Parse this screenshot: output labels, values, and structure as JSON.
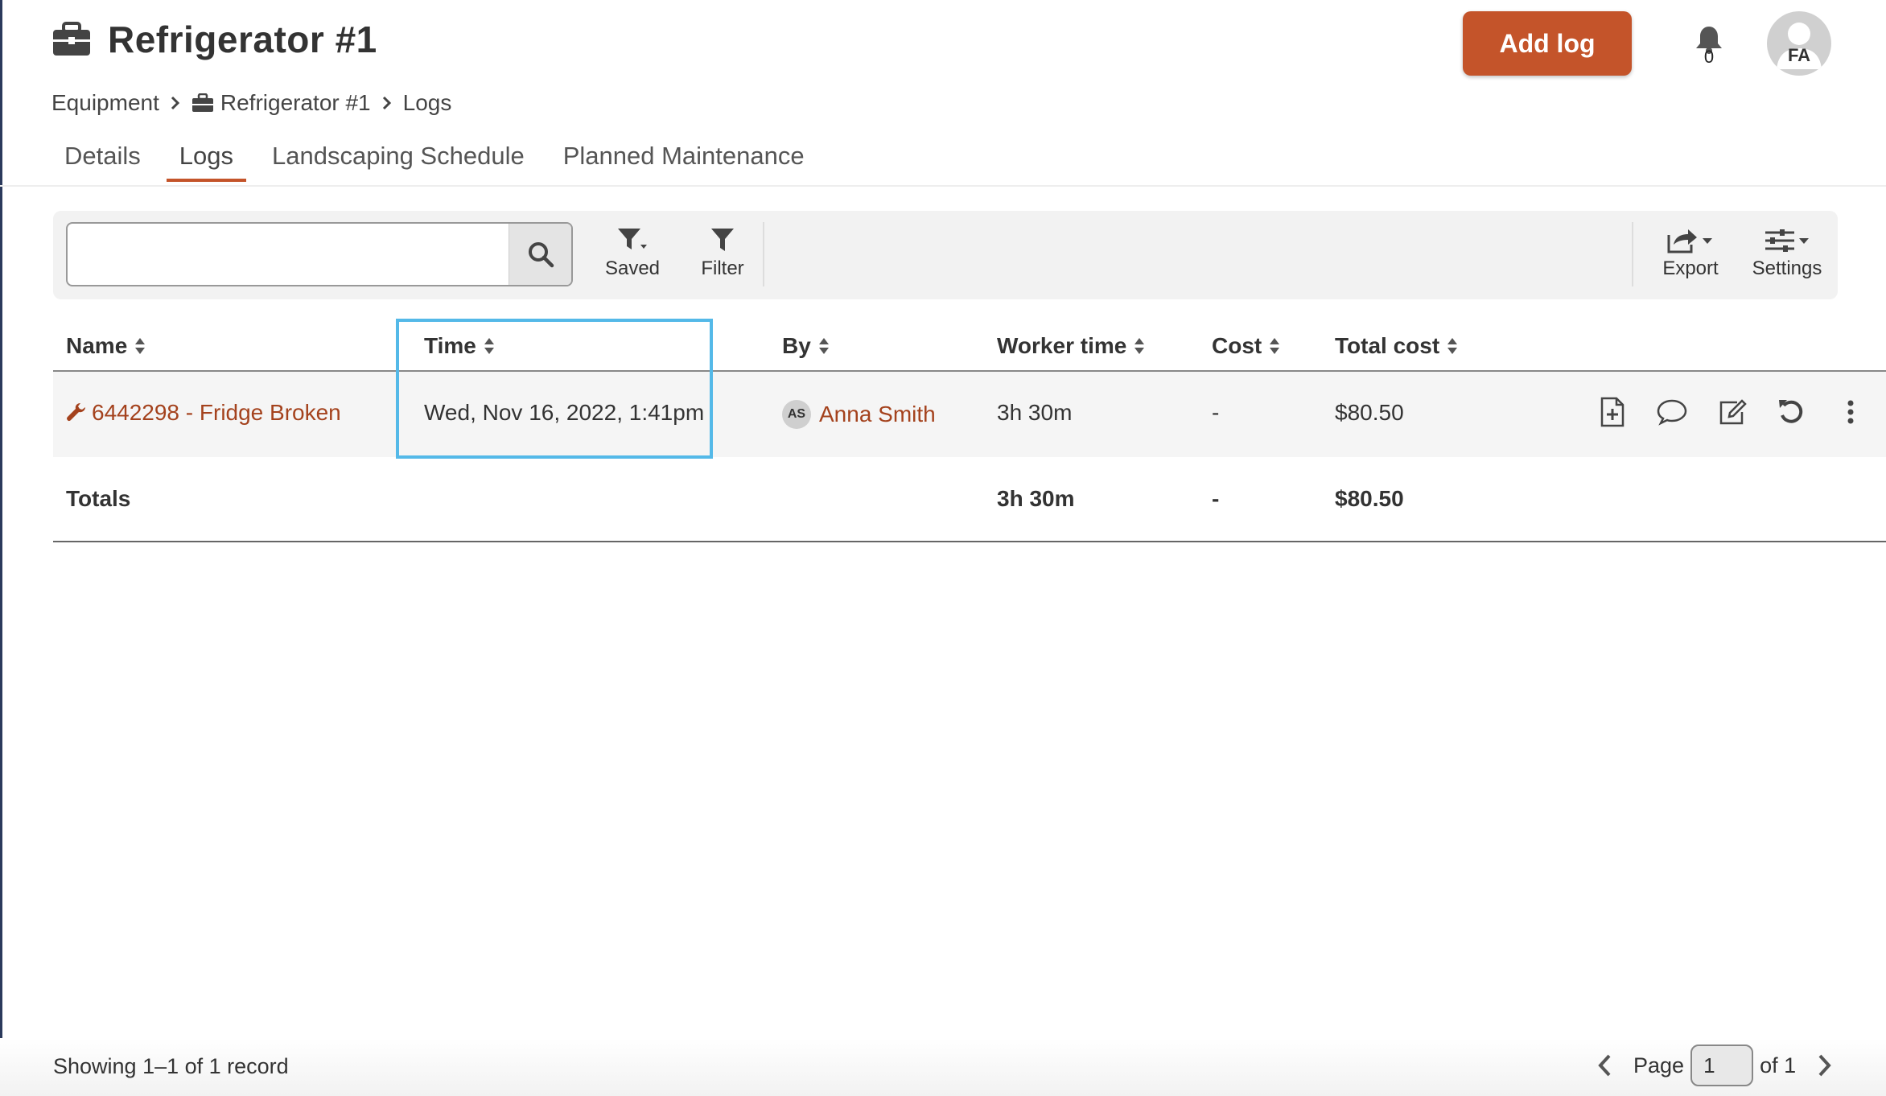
{
  "header": {
    "title": "Refrigerator #1",
    "add_log_label": "Add log",
    "notification_count": "0",
    "user_initials": "FA"
  },
  "breadcrumb": {
    "items": [
      "Equipment",
      "Refrigerator #1",
      "Logs"
    ]
  },
  "tabs": [
    {
      "label": "Details",
      "active": false
    },
    {
      "label": "Logs",
      "active": true
    },
    {
      "label": "Landscaping Schedule",
      "active": false
    },
    {
      "label": "Planned Maintenance",
      "active": false
    }
  ],
  "toolbar": {
    "search_value": "",
    "search_placeholder": "",
    "saved_label": "Saved",
    "filter_label": "Filter",
    "export_label": "Export",
    "settings_label": "Settings"
  },
  "table": {
    "columns": [
      "Name",
      "Time",
      "By",
      "Worker time",
      "Cost",
      "Total cost"
    ],
    "rows": [
      {
        "name": "6442298 - Fridge Broken",
        "time": "Wed, Nov 16, 2022, 1:41pm",
        "by_initials": "AS",
        "by": "Anna Smith",
        "worker_time": "3h 30m",
        "cost": "-",
        "total_cost": "$80.50"
      }
    ],
    "totals": {
      "label": "Totals",
      "worker_time": "3h 30m",
      "cost": "-",
      "total_cost": "$80.50"
    }
  },
  "footer": {
    "showing": "Showing 1–1 of 1 record",
    "page_label": "Page",
    "page_value": "1",
    "of_label": "of 1"
  },
  "colors": {
    "accent": "#c4542a",
    "link": "#a4421d",
    "highlight": "#54b9e8"
  }
}
